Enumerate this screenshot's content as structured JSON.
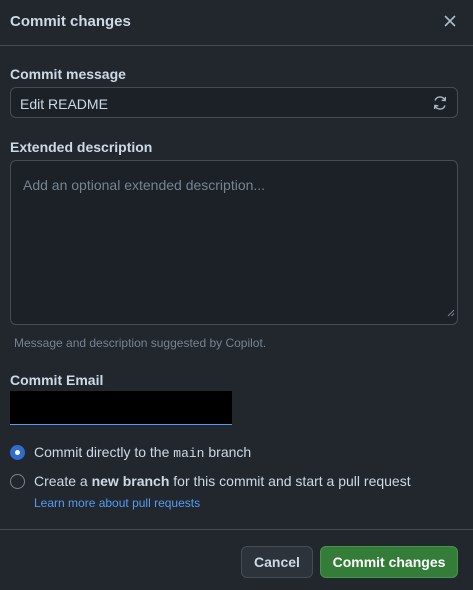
{
  "header": {
    "title": "Commit changes",
    "close_icon": "close-icon"
  },
  "commit_message": {
    "label": "Commit message",
    "value": "Edit README",
    "refresh_icon": "sync-icon"
  },
  "extended_description": {
    "label": "Extended description",
    "placeholder": "Add an optional extended description..."
  },
  "hint": "Message and description suggested by Copilot.",
  "commit_email": {
    "label": "Commit Email",
    "redacted": true
  },
  "options": {
    "direct": {
      "prefix": "Commit directly to the ",
      "branch": "main",
      "suffix": " branch",
      "checked": true
    },
    "new_branch": {
      "prefix": "Create a ",
      "bold": "new branch",
      "suffix": " for this commit and start a pull request",
      "checked": false
    }
  },
  "learn_more": "Learn more about pull requests",
  "buttons": {
    "cancel": "Cancel",
    "commit": "Commit changes"
  },
  "colors": {
    "background": "#22272e",
    "input_bg": "#1c2128",
    "border": "#444c56",
    "accent_blue": "#316dca",
    "link": "#539bf5",
    "commit_green": "#347d39"
  }
}
